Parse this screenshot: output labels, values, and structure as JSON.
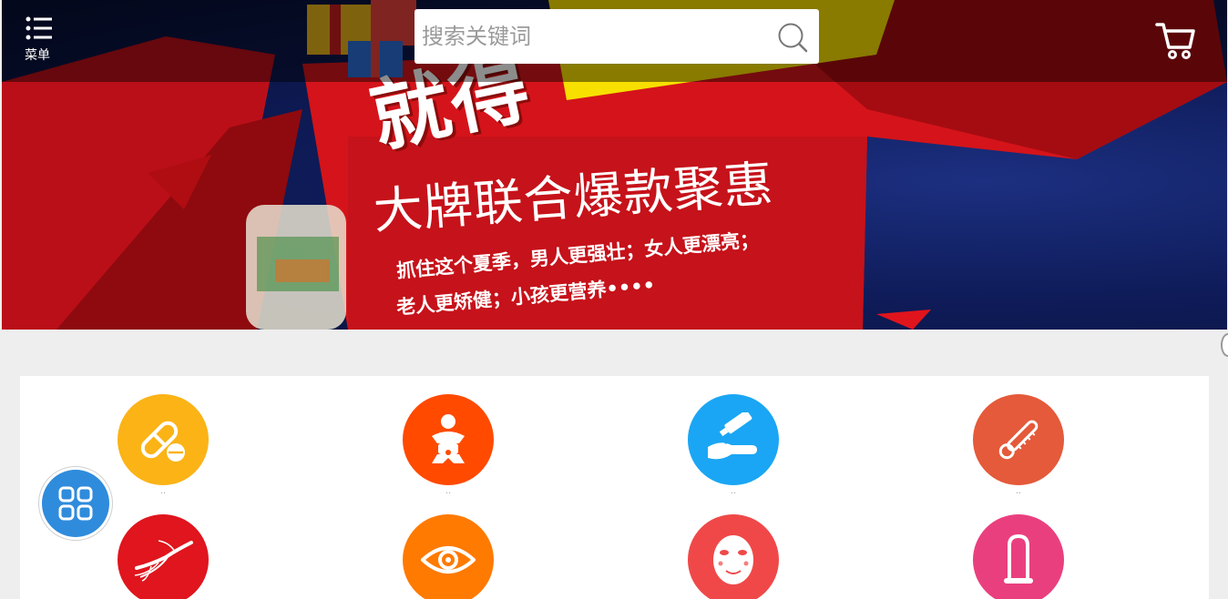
{
  "header": {
    "menu_label": "菜单",
    "search_placeholder": "搜索关键词"
  },
  "banner": {
    "headline": "就得",
    "subline": "大牌联合爆款聚惠",
    "desc_line1": "抓住这个夏季，男人更强壮；女人更漂亮；",
    "desc_line2": "老人更矫健；小孩更营养••••"
  },
  "categories": [
    {
      "icon": "pill-icon",
      "color": "#fbb316",
      "label": "··"
    },
    {
      "icon": "baby-icon",
      "color": "#ff4a00",
      "label": "··"
    },
    {
      "icon": "hand-cream-icon",
      "color": "#1aa6f4",
      "label": "··"
    },
    {
      "icon": "thermometer-icon",
      "color": "#e45a3a",
      "label": "··"
    },
    {
      "icon": "ginseng-icon",
      "color": "#e0151d",
      "label": ""
    },
    {
      "icon": "eye-icon",
      "color": "#ff7a00",
      "label": ""
    },
    {
      "icon": "face-mask-icon",
      "color": "#f04848",
      "label": ""
    },
    {
      "icon": "condom-icon",
      "color": "#ea3f7e",
      "label": ""
    }
  ],
  "colors": {
    "topbar": "rgba(0,0,0,0.45)",
    "banner_red": "#d4141a",
    "accent_yellow": "#f7e000",
    "fab_blue": "#2f8bdc"
  }
}
